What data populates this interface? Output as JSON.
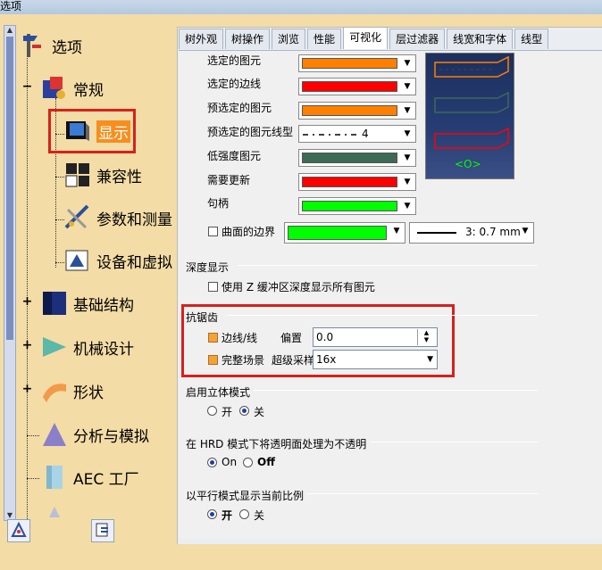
{
  "window": {
    "title": "选项"
  },
  "tree": {
    "root": "选项",
    "items": [
      {
        "label": "常规"
      },
      {
        "label": "显示"
      },
      {
        "label": "兼容性"
      },
      {
        "label": "参数和测量"
      },
      {
        "label": "设备和虚拟"
      },
      {
        "label": "基础结构"
      },
      {
        "label": "机械设计"
      },
      {
        "label": "形状"
      },
      {
        "label": "分析与模拟"
      },
      {
        "label": "AEC 工厂"
      }
    ]
  },
  "tabs": [
    "树外观",
    "树操作",
    "浏览",
    "性能",
    "可视化",
    "层过滤器",
    "线宽和字体",
    "线型"
  ],
  "active_tab": "可视化",
  "colors": {
    "selected_element": "#ff8000",
    "selected_edge": "#ff0000",
    "preselected_element": "#ff8000",
    "low_intensity": "#3d6a55",
    "needs_update": "#ff0000",
    "handle": "#00ff00",
    "surface_boundary": "#00ff00",
    "selection_accent": "#f78e1e",
    "annotation_red": "#d8201c"
  },
  "visualization": {
    "selected_element_label": "选定的图元",
    "selected_edge_label": "选定的边线",
    "preselected_element_label": "预选定的图元",
    "preselected_linetype_label": "预选定的图元线型",
    "preselected_linetype_value": "4",
    "low_intensity_label": "低强度图元",
    "needs_update_label": "需要更新",
    "handle_label": "句柄",
    "surface_boundary_label": "曲面的边界",
    "line_width_value": "3: 0.7 mm"
  },
  "depth": {
    "title": "深度显示",
    "zbuffer_label": "使用 Z 缓冲区深度显示所有图元"
  },
  "antialias": {
    "title": "抗锯齿",
    "edge_label": "边线/线",
    "offset_label": "偏置",
    "offset_value": "0.0",
    "scene_label": "完整场景",
    "supersample_label": "超级采样",
    "supersample_value": "16x"
  },
  "stereo": {
    "title": "启用立体模式",
    "on": "开",
    "off": "关"
  },
  "hrd": {
    "title": "在 HRD 模式下将透明面处理为不透明",
    "on": "On",
    "off": "Off"
  },
  "parallel": {
    "title": "以平行模式显示当前比例",
    "on": "开",
    "off": "关"
  }
}
